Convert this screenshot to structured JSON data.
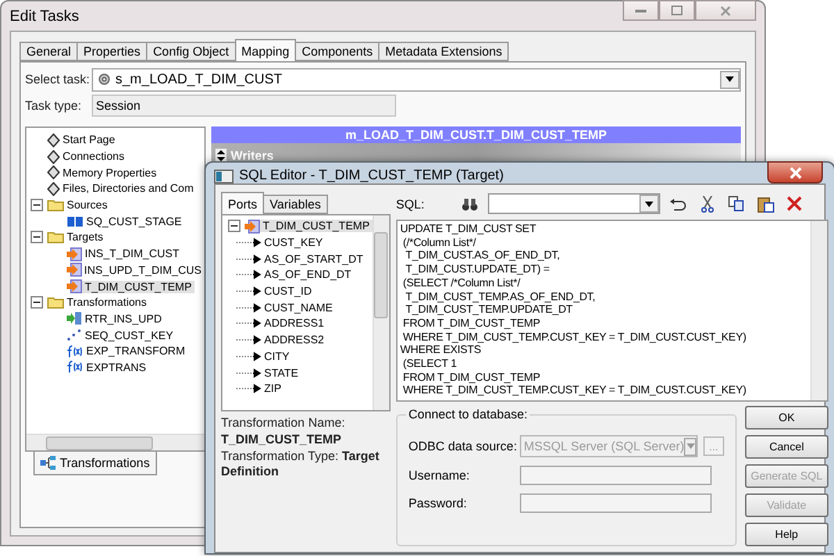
{
  "main_window": {
    "title": "Edit Tasks",
    "tabs": [
      {
        "label": "General",
        "selected": false
      },
      {
        "label": "Properties",
        "selected": false
      },
      {
        "label": "Config Object",
        "selected": false
      },
      {
        "label": "Mapping",
        "selected": true
      },
      {
        "label": "Components",
        "selected": false
      },
      {
        "label": "Metadata Extensions",
        "selected": false
      }
    ],
    "select_task": {
      "label": "Select task:",
      "value": "s_m_LOAD_T_DIM_CUST"
    },
    "task_type": {
      "label": "Task type:",
      "value": "Session"
    },
    "tree": [
      {
        "label": "Start Page",
        "kind": "page",
        "selected": false
      },
      {
        "label": "Connections",
        "kind": "page",
        "selected": false
      },
      {
        "label": "Memory Properties",
        "kind": "page",
        "selected": false
      },
      {
        "label": "Files, Directories and Com",
        "kind": "page",
        "selected": false
      },
      {
        "label": "Sources",
        "kind": "folder",
        "selected": false,
        "expanded": true,
        "children": [
          {
            "label": "SQ_CUST_STAGE",
            "kind": "source",
            "selected": false
          }
        ]
      },
      {
        "label": "Targets",
        "kind": "folder",
        "selected": false,
        "expanded": true,
        "children": [
          {
            "label": "INS_T_DIM_CUST",
            "kind": "target",
            "selected": false
          },
          {
            "label": "INS_UPD_T_DIM_CUS",
            "kind": "target",
            "selected": false
          },
          {
            "label": "T_DIM_CUST_TEMP",
            "kind": "target",
            "selected": true
          }
        ]
      },
      {
        "label": "Transformations",
        "kind": "folder",
        "selected": false,
        "expanded": true,
        "children": [
          {
            "label": "RTR_INS_UPD",
            "kind": "router",
            "selected": false
          },
          {
            "label": "SEQ_CUST_KEY",
            "kind": "sequence",
            "selected": false
          },
          {
            "label": "EXP_TRANSFORM",
            "kind": "expression",
            "selected": false
          },
          {
            "label": "EXPTRANS",
            "kind": "expression",
            "selected": false
          }
        ]
      }
    ],
    "bottom_tab": "Transformations",
    "header": "m_LOAD_T_DIM_CUST.T_DIM_CUST_TEMP",
    "section": "Writers"
  },
  "sql_editor": {
    "title": "SQL Editor - T_DIM_CUST_TEMP (Target)",
    "tabs": [
      {
        "label": "Ports",
        "selected": true
      },
      {
        "label": "Variables",
        "selected": false
      }
    ],
    "ports_tree": {
      "label": "T_DIM_CUST_TEMP",
      "expanded": true,
      "children": [
        "CUST_KEY",
        "AS_OF_START_DT",
        "AS_OF_END_DT",
        "CUST_ID",
        "CUST_NAME",
        "ADDRESS1",
        "ADDRESS2",
        "CITY",
        "STATE",
        "ZIP"
      ]
    },
    "info": {
      "name_label": "Transformation Name:",
      "name": "T_DIM_CUST_TEMP",
      "type_line": "Transformation Type:  **Target Definition**"
    },
    "sql_label": "SQL:",
    "sql_lines": [
      "UPDATE T_DIM_CUST SET",
      " (/*Column List*/",
      "  T_DIM_CUST.AS_OF_END_DT,",
      "  T_DIM_CUST.UPDATE_DT) =",
      " (SELECT /*Column List*/",
      "  T_DIM_CUST_TEMP.AS_OF_END_DT,",
      "  T_DIM_CUST_TEMP.UPDATE_DT",
      " FROM T_DIM_CUST_TEMP",
      " WHERE T_DIM_CUST_TEMP.CUST_KEY = T_DIM_CUST.CUST_KEY)",
      "WHERE EXISTS",
      " (SELECT 1",
      " FROM T_DIM_CUST_TEMP",
      " WHERE T_DIM_CUST_TEMP.CUST_KEY = T_DIM_CUST.CUST_KEY)"
    ],
    "connect": {
      "title": "Connect to database:",
      "fields": [
        {
          "label": "ODBC data source:",
          "kind": "select",
          "value": "MSSQL Server (SQL Server)",
          "disabled": true,
          "browse": "..."
        },
        {
          "label": "Username:",
          "kind": "text"
        },
        {
          "label": "Password:",
          "kind": "password"
        }
      ]
    },
    "buttons": [
      {
        "label": "OK",
        "disabled": false
      },
      {
        "label": "Cancel",
        "disabled": false
      },
      {
        "label": "Generate SQL",
        "disabled": true
      },
      {
        "label": "Validate",
        "disabled": true
      },
      {
        "label": "Help",
        "disabled": false
      }
    ]
  }
}
